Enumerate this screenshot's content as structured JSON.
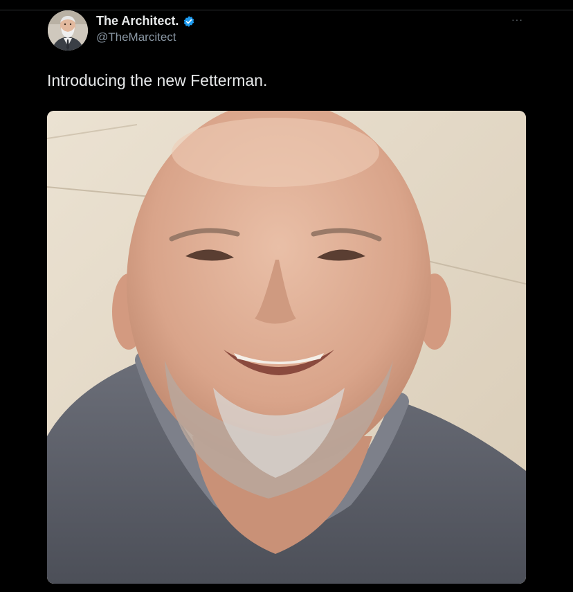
{
  "tweet": {
    "author_name": "The Architect.",
    "author_handle": "@TheMarcitect",
    "verified": true,
    "text": "Introducing the new Fetterman.",
    "more_glyph": "···"
  },
  "icons": {
    "avatar": "avatar-photo",
    "verified": "verified-badge-icon",
    "more": "more-options-icon"
  },
  "colors": {
    "background": "#000000",
    "primary_text": "#e7e9ea",
    "secondary_text": "#8b98a5",
    "verified_blue": "#1d9bf0"
  }
}
